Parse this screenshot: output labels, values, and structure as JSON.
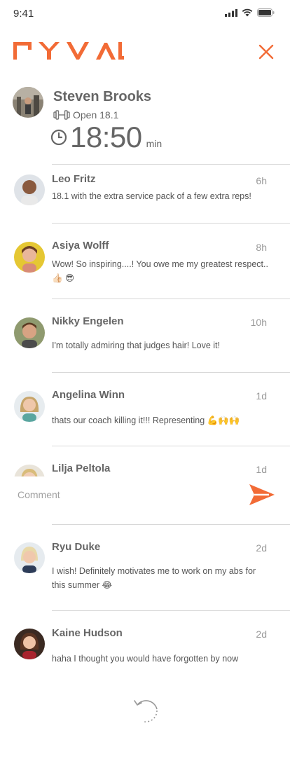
{
  "status_bar": {
    "time": "9:41"
  },
  "brand": {
    "logo_text": "RYVAL",
    "accent_color": "#f26b36"
  },
  "post": {
    "author": "Steven Brooks",
    "workout": "Open 18.1",
    "time_value": "18:50",
    "time_unit": "min"
  },
  "comments": [
    {
      "name": "Leo Fritz",
      "time": "6h",
      "text": "18.1 with the extra service pack of a few extra reps!"
    },
    {
      "name": "Asiya Wolff",
      "time": "8h",
      "text": "Wow! So inspiring....! You owe me my greatest respect.. 👍🏻 😎"
    },
    {
      "name": "Nikky Engelen",
      "time": "10h",
      "text": "I'm totally admiring that judges hair! Love it!"
    },
    {
      "name": "Angelina Winn",
      "time": "1d",
      "text": "thats our coach killing it!!! Representing 💪🙌🙌"
    },
    {
      "name": "Lilja Peltola",
      "time": "1d",
      "text": ""
    },
    {
      "name": "Ryu Duke",
      "time": "2d",
      "text": " I wish! Definitely motivates me to work on my abs for this summer 😂"
    },
    {
      "name": "Kaine Hudson",
      "time": "2d",
      "text": "haha I thought you would have forgotten by now"
    }
  ],
  "composer": {
    "placeholder": "Comment"
  }
}
